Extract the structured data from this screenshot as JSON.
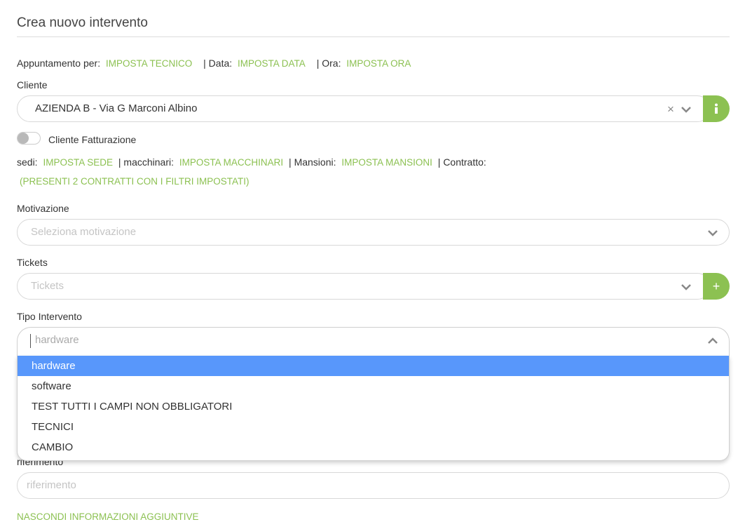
{
  "page_title": "Crea nuovo intervento",
  "appointment": {
    "label": "Appuntamento per:",
    "tech_link": "IMPOSTA TECNICO",
    "data_label": "| Data:",
    "data_link": "IMPOSTA DATA",
    "ora_label": "| Ora:",
    "ora_link": "IMPOSTA ORA"
  },
  "cliente": {
    "label": "Cliente",
    "value": "AZIENDA B - Via G Marconi Albino",
    "info_icon": "info-icon"
  },
  "cliente_fatturazione": {
    "label": "Cliente Fatturazione"
  },
  "details": {
    "sedi_label": "sedi:",
    "sedi_link": "IMPOSTA SEDE",
    "macchinari_label": "| macchinari:",
    "macchinari_link": "IMPOSTA MACCHINARI",
    "mansioni_label": "| Mansioni:",
    "mansioni_link": "IMPOSTA MANSIONI",
    "contratto_label": "| Contratto:",
    "contratti_link": "(PRESENTI 2 CONTRATTI CON I FILTRI IMPOSTATI)"
  },
  "motivazione": {
    "label": "Motivazione",
    "placeholder": "Seleziona motivazione"
  },
  "tickets": {
    "label": "Tickets",
    "placeholder": "Tickets",
    "add_label": "+"
  },
  "tipo_intervento": {
    "label": "Tipo Intervento",
    "search_value": "hardware",
    "options": [
      "hardware",
      "software",
      "TEST TUTTI I CAMPI NON OBBLIGATORI",
      "TECNICI",
      "CAMBIO"
    ],
    "selected": "hardware"
  },
  "riferimento": {
    "label": "riferimento",
    "placeholder": "riferimento"
  },
  "footer_link": "NASCONDI INFORMAZIONI AGGIUNTIVE",
  "colors": {
    "accent": "#8cc152",
    "highlight": "#5897fb"
  }
}
